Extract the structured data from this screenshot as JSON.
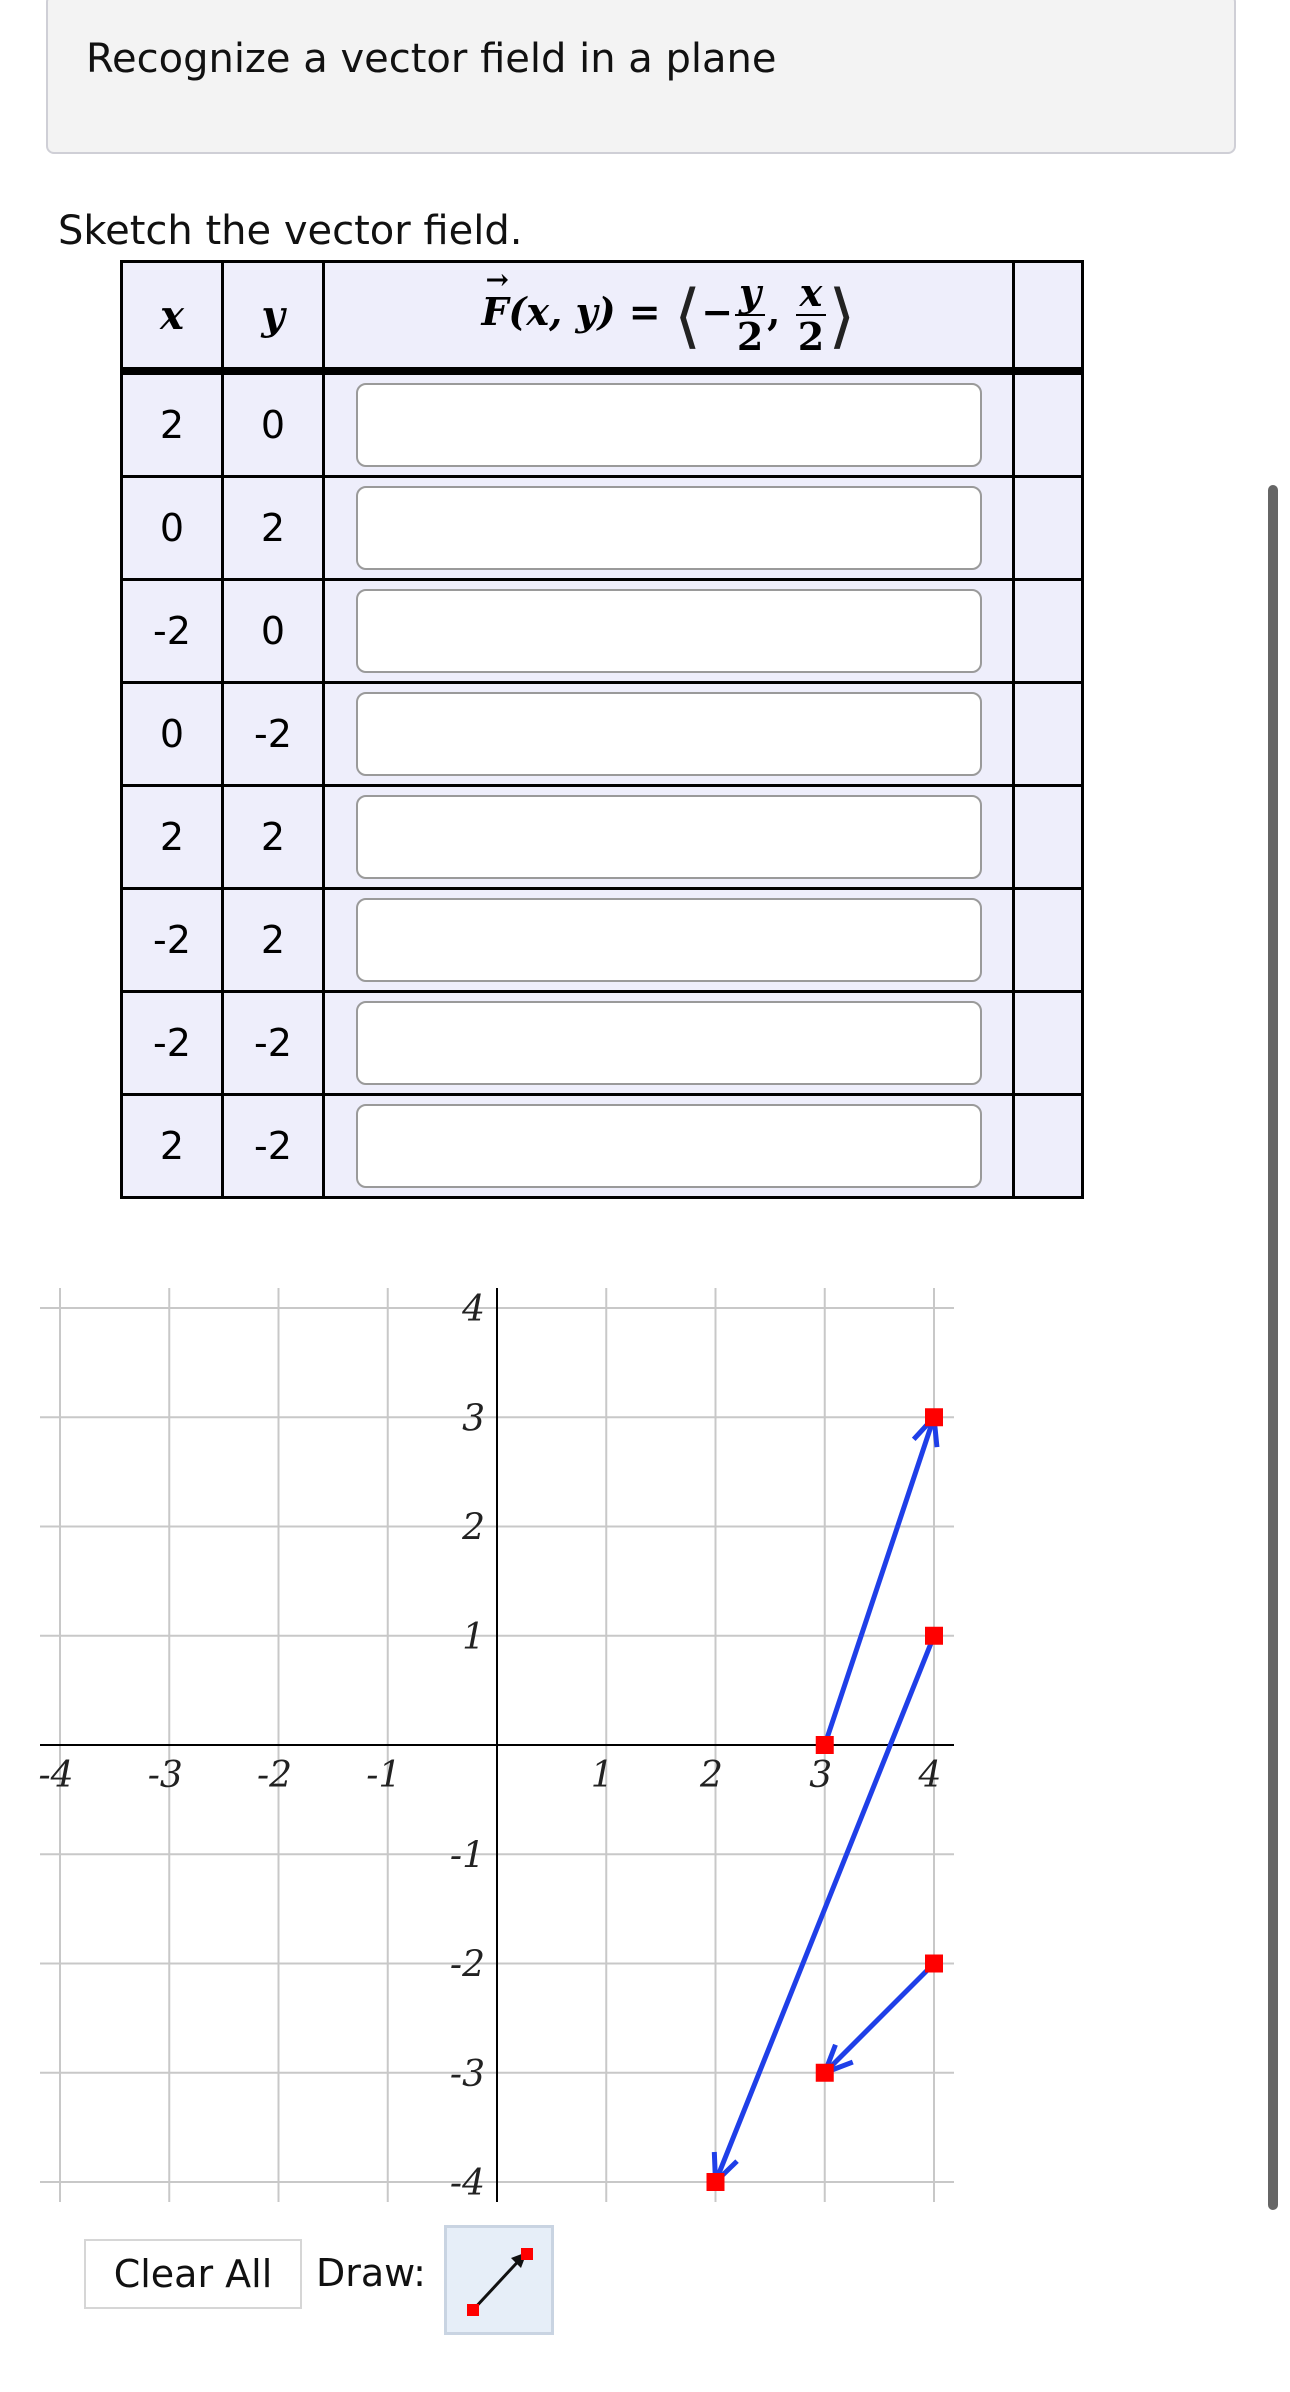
{
  "header": {
    "title": "Recognize a vector field in a plane"
  },
  "instruction": "Sketch the vector field.",
  "table": {
    "col_x": "x",
    "col_y": "y",
    "formula": {
      "lhs": "F(x, y) = ",
      "num1": "y",
      "den1": "2",
      "num2": "x",
      "den2": "2"
    },
    "rows": [
      {
        "x": "2",
        "y": "0",
        "value": ""
      },
      {
        "x": "0",
        "y": "2",
        "value": ""
      },
      {
        "x": "-2",
        "y": "0",
        "value": ""
      },
      {
        "x": "0",
        "y": "-2",
        "value": ""
      },
      {
        "x": "2",
        "y": "2",
        "value": ""
      },
      {
        "x": "-2",
        "y": "2",
        "value": ""
      },
      {
        "x": "-2",
        "y": "-2",
        "value": ""
      },
      {
        "x": "2",
        "y": "-2",
        "value": ""
      }
    ]
  },
  "graph": {
    "xlim": [
      -4,
      4
    ],
    "ylim": [
      -4,
      4
    ],
    "x_ticks": [
      "-4",
      "-3",
      "-2",
      "-1",
      "1",
      "2",
      "3",
      "4"
    ],
    "y_ticks": [
      "4",
      "3",
      "2",
      "1",
      "-1",
      "-2",
      "-3",
      "-4"
    ],
    "grid": true,
    "arrow_color": "#1f3fe8",
    "point_color": "#ff0000",
    "vectors": [
      {
        "from": [
          3,
          0
        ],
        "to": [
          4,
          3
        ]
      },
      {
        "from": [
          4,
          1
        ],
        "to": [
          2,
          -4
        ]
      },
      {
        "from": [
          4,
          -2
        ],
        "to": [
          3,
          -3
        ]
      }
    ]
  },
  "controls": {
    "clear_label": "Clear All",
    "draw_label": "Draw:",
    "draw_tool": "vector-draw-icon"
  }
}
